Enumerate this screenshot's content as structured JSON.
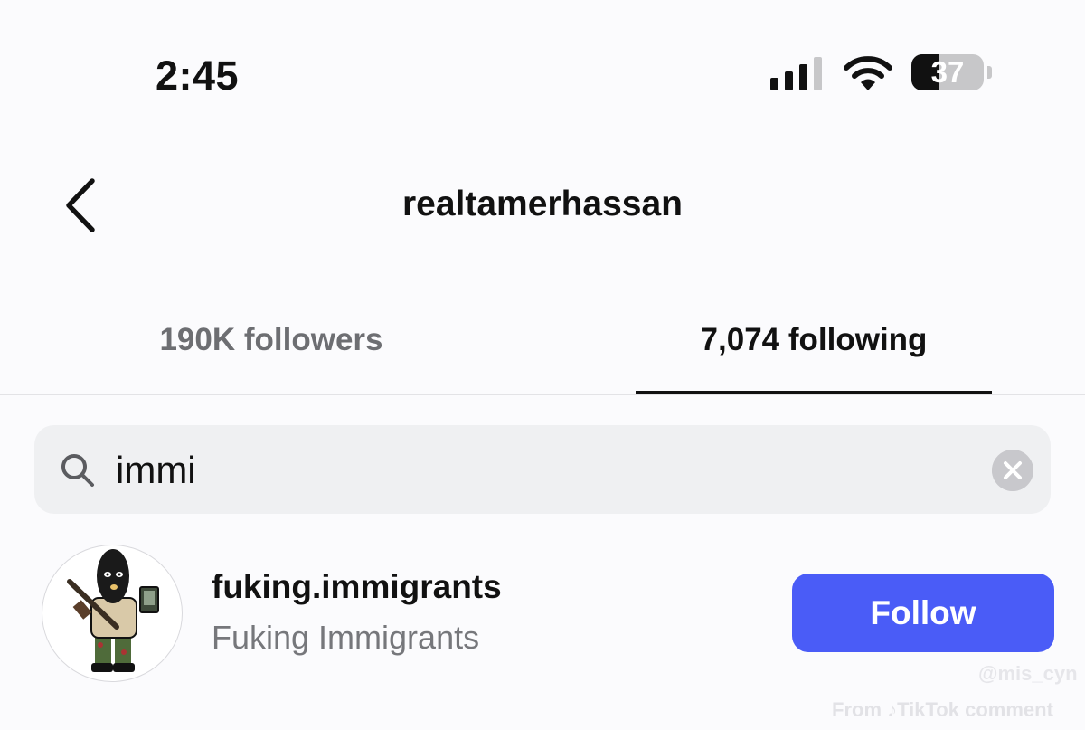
{
  "status_bar": {
    "time": "2:45",
    "battery_level": "37",
    "signal_icon": "cellular-signal-icon",
    "wifi_icon": "wifi-icon",
    "battery_icon": "battery-icon"
  },
  "header": {
    "back_icon": "chevron-left-icon",
    "title": "realtamerhassan"
  },
  "tabs": [
    {
      "label": "190K followers",
      "selected": false
    },
    {
      "label": "7,074 following",
      "selected": true
    }
  ],
  "search": {
    "value": "immi",
    "search_icon": "search-icon",
    "clear_icon": "clear-x-icon"
  },
  "results": [
    {
      "username": "fuking.immigrants",
      "full_name": "Fuking Immigrants",
      "button_label": "Follow"
    }
  ],
  "watermark": {
    "user": "@mis_cyn",
    "source": "From ♪TikTok comment"
  },
  "colors": {
    "follow_button": "#4a5cf7",
    "search_bg": "#eff0f2",
    "secondary_text": "#76777b"
  }
}
